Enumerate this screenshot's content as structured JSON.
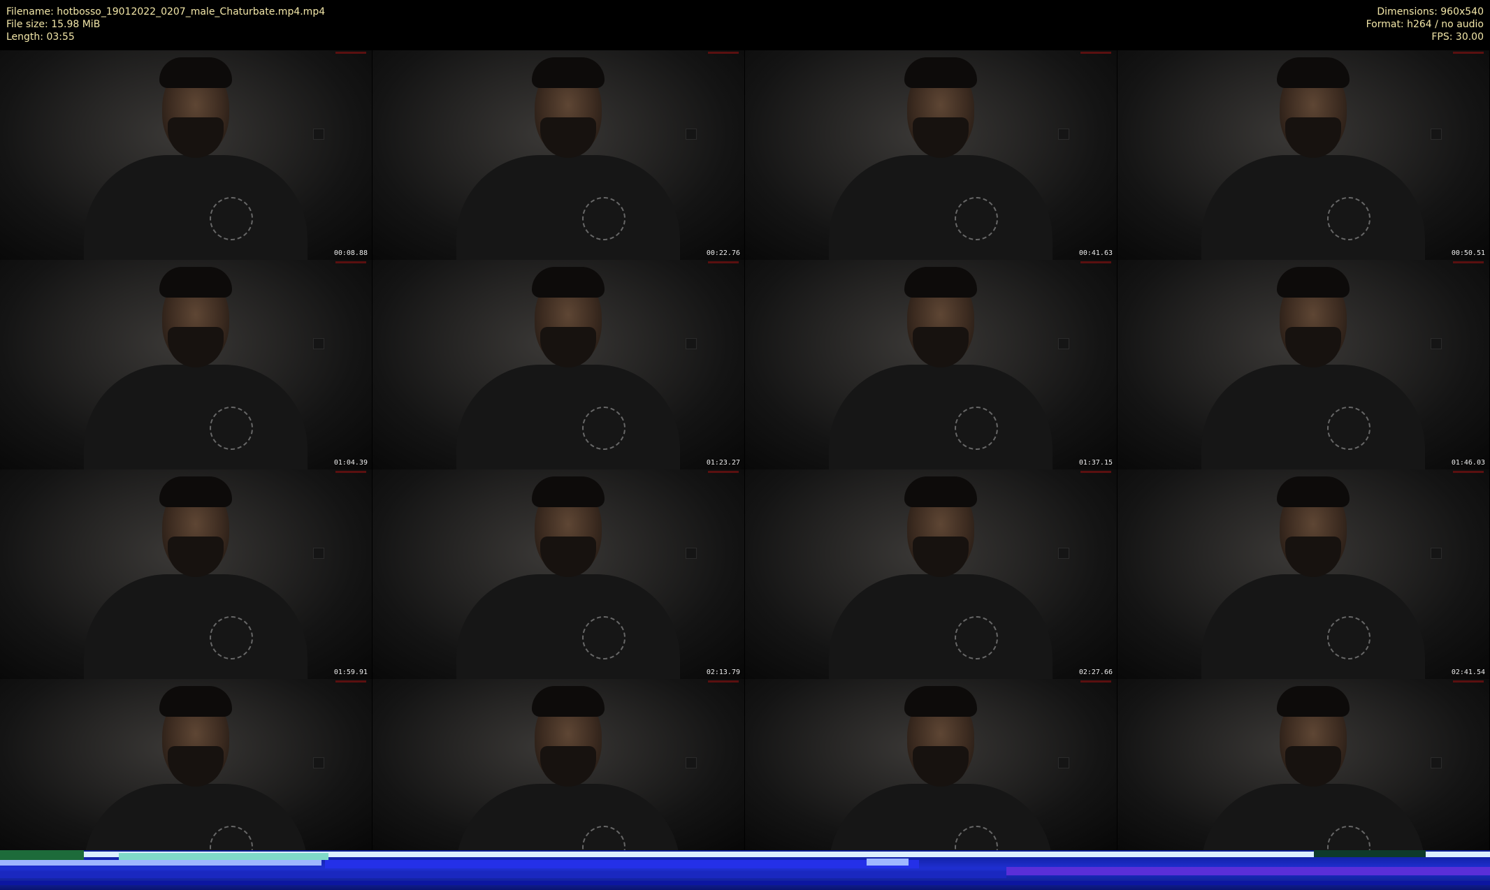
{
  "header": {
    "filename": "Filename: hotbosso_19012022_0207_male_Chaturbate.mp4.mp4",
    "filesize": "File size: 15.98 MiB",
    "length": "Length: 03:55",
    "dimensions": "Dimensions: 960x540",
    "format": "Format: h264 / no audio",
    "fps": "FPS: 30.00"
  },
  "thumbnails": [
    {
      "timestamp": "00:08.88"
    },
    {
      "timestamp": "00:22.76"
    },
    {
      "timestamp": "00:41.63"
    },
    {
      "timestamp": "00:50.51"
    },
    {
      "timestamp": "01:04.39"
    },
    {
      "timestamp": "01:23.27"
    },
    {
      "timestamp": "01:37.15"
    },
    {
      "timestamp": "01:46.03"
    },
    {
      "timestamp": "01:59.91"
    },
    {
      "timestamp": "02:13.79"
    },
    {
      "timestamp": "02:27.66"
    },
    {
      "timestamp": "02:41.54"
    },
    {
      "timestamp": ""
    },
    {
      "timestamp": ""
    },
    {
      "timestamp": ""
    },
    {
      "timestamp": ""
    }
  ],
  "colors": {
    "header_text": "#f2e6a8",
    "background": "#000000",
    "glitch_band": "#1f2fd1"
  }
}
